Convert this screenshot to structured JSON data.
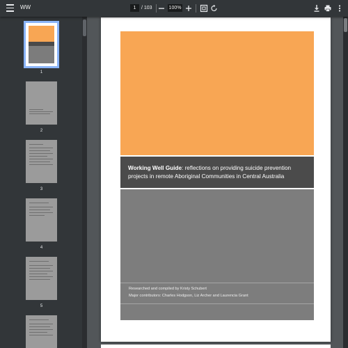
{
  "toolbar": {
    "title": "WW",
    "current_page": "1",
    "page_separator": "/ 103",
    "zoom": "100%",
    "zoom_out_icon": "minus-icon",
    "zoom_in_icon": "plus-icon",
    "fit_icon": "fit-to-page-icon",
    "rotate_icon": "rotate-icon",
    "download_icon": "download-icon",
    "print_icon": "print-icon",
    "more_icon": "more-vert-icon"
  },
  "thumbnails": [
    {
      "number": "1",
      "selected": true
    },
    {
      "number": "2",
      "selected": false
    },
    {
      "number": "3",
      "selected": false
    },
    {
      "number": "4",
      "selected": false
    },
    {
      "number": "5",
      "selected": false
    },
    {
      "number": "",
      "selected": false
    }
  ],
  "cover": {
    "title_bold": "Working Well Guide",
    "title_rest": ": reflections on providing suicide prevention projects in remote Aboriginal Communities in Central Australia",
    "credit_line_1": "Researched and compiled by Kristy Schubert",
    "credit_line_2": "Major contributors: Charles Hodgson, Liz Archer and Laurencia Grant"
  },
  "colors": {
    "toolbar_bg": "#323639",
    "viewer_bg": "#525659",
    "cover_orange": "#f8a654",
    "cover_dark": "#4b4b4b",
    "cover_grey": "#7d7d7d",
    "selected_outline": "#8ab4f8"
  }
}
